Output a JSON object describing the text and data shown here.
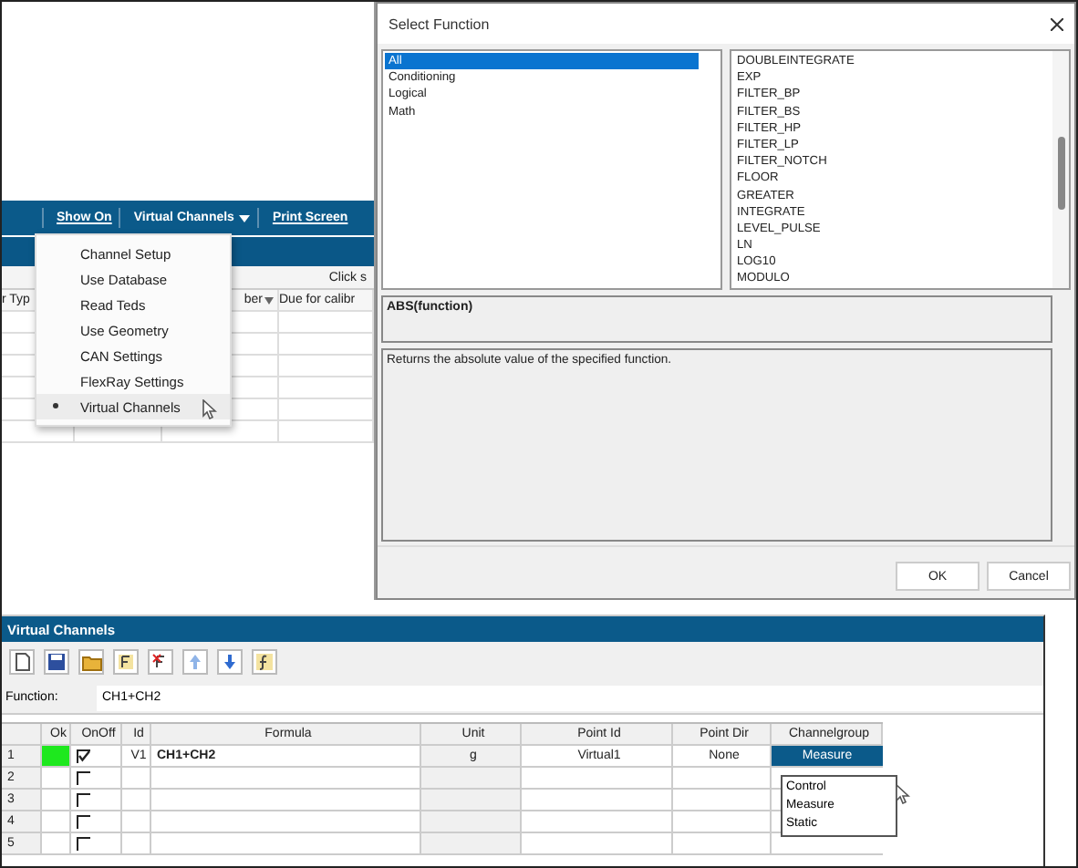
{
  "app_toolbar": {
    "items": [
      {
        "label": "Show On",
        "underlined": true,
        "dropdown": false
      },
      {
        "label": "Virtual Channels",
        "underlined": false,
        "dropdown": true
      },
      {
        "label": "Print Screen",
        "underlined": true,
        "dropdown": false
      }
    ]
  },
  "app_menu": {
    "items": [
      {
        "label": "Channel Setup",
        "selected": false
      },
      {
        "label": "Use Database",
        "selected": false
      },
      {
        "label": "Read Teds",
        "selected": false
      },
      {
        "label": "Use Geometry",
        "selected": false
      },
      {
        "label": "CAN Settings",
        "selected": false
      },
      {
        "label": "FlexRay Settings",
        "selected": false
      },
      {
        "label": "Virtual Channels",
        "selected": true
      }
    ]
  },
  "app_table": {
    "status_text": "Click s",
    "columns": [
      "r Typ",
      "ber",
      "Due for calibr"
    ]
  },
  "dialog": {
    "title": "Select Function",
    "categories": [
      {
        "label": "All",
        "selected": true
      },
      {
        "label": "Conditioning",
        "selected": false
      },
      {
        "label": "Logical",
        "selected": false
      },
      {
        "label": "Math",
        "selected": false
      }
    ],
    "functions": [
      "DOUBLEINTEGRATE",
      "EXP",
      "FILTER_BP",
      "FILTER_BS",
      "FILTER_HP",
      "FILTER_LP",
      "FILTER_NOTCH",
      "FLOOR",
      "GREATER",
      "INTEGRATE",
      "LEVEL_PULSE",
      "LN",
      "LOG10",
      "MODULO"
    ],
    "syntax": "ABS(function)",
    "description": "Returns the absolute value of the specified function.",
    "buttons": [
      "OK",
      "Cancel"
    ]
  },
  "virtual_channels": {
    "title": "Virtual Channels",
    "function_label": "Function:",
    "function_value": "CH1+CH2",
    "columns": [
      "Ok",
      "OnOff",
      "Id",
      "Formula",
      "Unit",
      "Point Id",
      "Point Dir",
      "Channelgroup"
    ],
    "rows": [
      {
        "number": "1",
        "ok": true,
        "on": true,
        "id": "V1",
        "formula": "CH1+CH2",
        "unit": "g",
        "point_id": "Virtual1",
        "point_dir": "None",
        "channelgroup": "Measure",
        "selected": true
      },
      {
        "number": "2",
        "ok": false,
        "on": false,
        "selected": false
      },
      {
        "number": "3",
        "ok": false,
        "on": false,
        "selected": false
      },
      {
        "number": "4",
        "ok": false,
        "on": false,
        "selected": false
      },
      {
        "number": "5",
        "ok": false,
        "on": false,
        "selected": false
      }
    ],
    "dropdown_options": [
      "Control",
      "Measure",
      "Static"
    ]
  }
}
